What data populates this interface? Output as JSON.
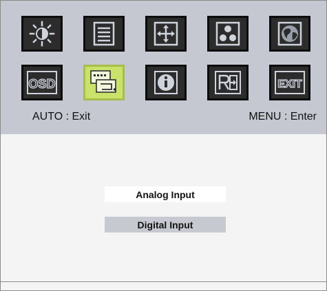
{
  "osd": {
    "icons_row1": [
      {
        "name": "brightness-icon"
      },
      {
        "name": "image-setup-icon"
      },
      {
        "name": "position-icon"
      },
      {
        "name": "color-icon"
      },
      {
        "name": "language-icon"
      }
    ],
    "icons_row2": [
      {
        "name": "osd-settings-icon",
        "label": "OSD"
      },
      {
        "name": "input-select-icon",
        "selected": true
      },
      {
        "name": "information-icon"
      },
      {
        "name": "reset-icon"
      },
      {
        "name": "exit-icon",
        "label": "EXIT"
      }
    ],
    "hint_left": "AUTO : Exit",
    "hint_right": "MENU : Enter"
  },
  "submenu": {
    "items": [
      {
        "label": "Analog Input",
        "highlighted": true
      },
      {
        "label": "Digital Input",
        "highlighted": false
      }
    ]
  },
  "colors": {
    "panel": "#c5c8d0",
    "icon_bg": "#2c2c2c",
    "selected_icon_bg": "#c9e36a",
    "body": "#f4f4f4",
    "highlight": "#ffffff",
    "item_bg": "#c7c9d1"
  }
}
